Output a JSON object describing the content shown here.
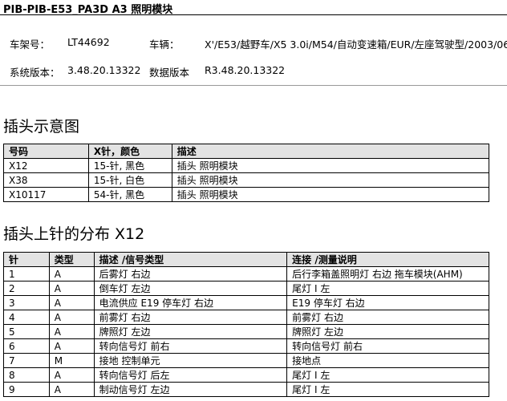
{
  "header": {
    "title": "PIB-PIB-E53_PA3D   A3 照明模块"
  },
  "info": {
    "vin_label": "车架号：",
    "vin": "LT44692",
    "vehicle_label": "车辆：",
    "vehicle": "X'/E53/越野车/X5 3.0i/M54/自动变速箱/EUR/左座驾驶型/2003/06",
    "sys_ver_label": "系统版本：",
    "sys_ver": "3.48.20.13322",
    "data_ver_label": "数据版本",
    "data_ver": "R3.48.20.13322"
  },
  "section1": {
    "title": "插头示意图",
    "headers": [
      "号码",
      "X针，颜色",
      "描述"
    ],
    "rows": [
      [
        "X12",
        "15-针, 黑色",
        "插头 照明模块"
      ],
      [
        "X38",
        "15-针, 白色",
        "插头 照明模块"
      ],
      [
        "X10117",
        "54-针, 黑色",
        "插头 照明模块"
      ]
    ]
  },
  "section2": {
    "title": "插头上针的分布 X12",
    "headers": [
      "针",
      "类型",
      "描述 /信号类型",
      "连接 /测量说明"
    ],
    "rows": [
      [
        "1",
        "A",
        "后雾灯 右边",
        "后行李箱盖照明灯 右边 拖车模块(AHM)"
      ],
      [
        "2",
        "A",
        "倒车灯 左边",
        "尾灯 I 左"
      ],
      [
        "3",
        "A",
        "电流供应 E19 停车灯 右边",
        "E19 停车灯 右边"
      ],
      [
        "4",
        "A",
        "前雾灯 右边",
        "前雾灯 右边"
      ],
      [
        "5",
        "A",
        "牌照灯 左边",
        "牌照灯 左边"
      ],
      [
        "6",
        "A",
        "转向信号灯 前右",
        "转向信号灯 前右"
      ],
      [
        "7",
        "M",
        "接地 控制单元",
        "接地点"
      ],
      [
        "8",
        "A",
        "转向信号灯 后左",
        "尾灯 I 左"
      ],
      [
        "9",
        "A",
        "制动信号灯 左边",
        "尾灯 I 左"
      ]
    ]
  }
}
